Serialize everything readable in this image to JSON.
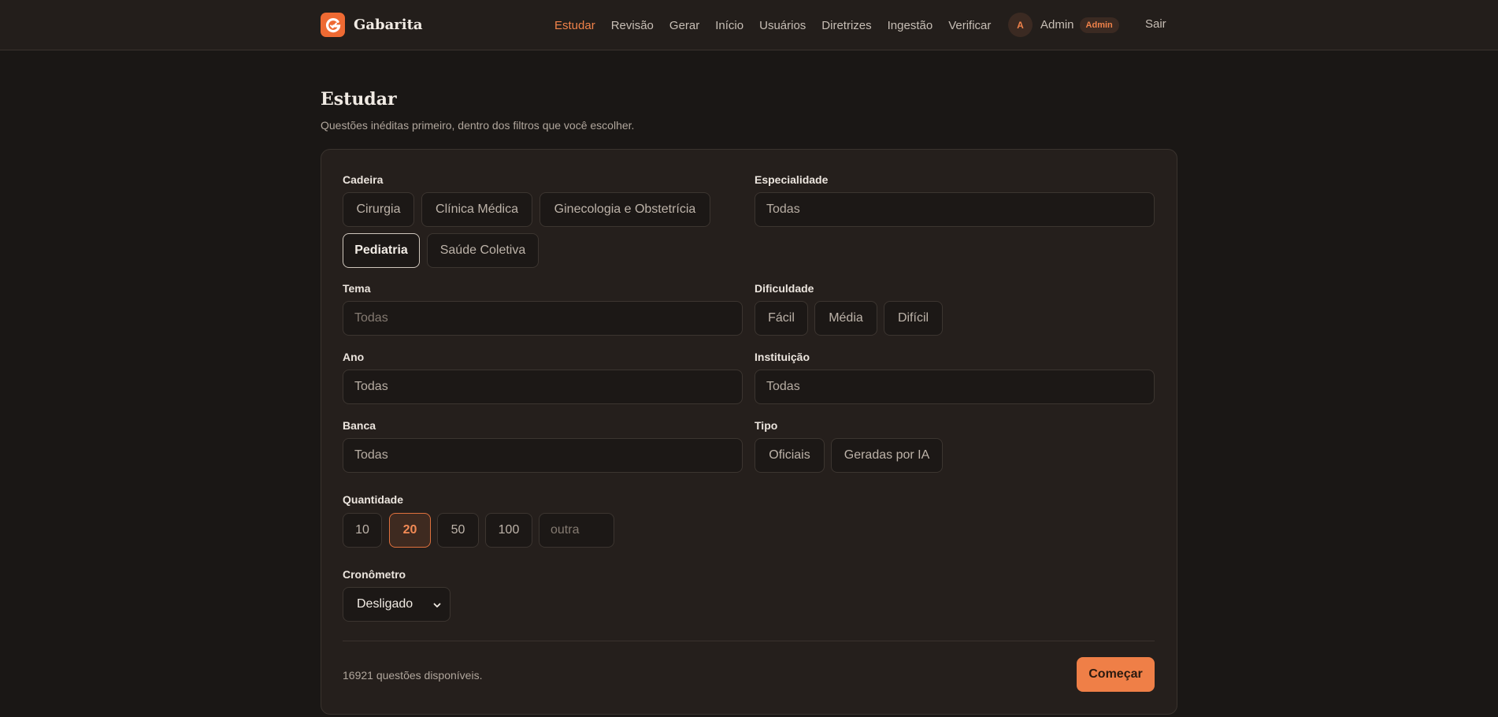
{
  "header": {
    "brand_name": "Gabarita",
    "nav": [
      {
        "label": "Estudar",
        "active": true
      },
      {
        "label": "Revisão"
      },
      {
        "label": "Gerar"
      },
      {
        "label": "Início"
      },
      {
        "label": "Usuários"
      },
      {
        "label": "Diretrizes"
      },
      {
        "label": "Ingestão"
      },
      {
        "label": "Verificar"
      }
    ],
    "user": {
      "avatar_initial": "A",
      "name": "Admin",
      "role_badge": "Admin"
    },
    "logout_label": "Sair"
  },
  "page": {
    "title": "Estudar",
    "subtitle": "Questões inéditas primeiro, dentro dos filtros que você escolher."
  },
  "filters": {
    "cadeira": {
      "label": "Cadeira",
      "options": [
        "Cirurgia",
        "Clínica Médica",
        "Ginecologia e Obstetrícia",
        "Pediatria",
        "Saúde Coletiva"
      ],
      "selected": "Pediatria"
    },
    "especialidade": {
      "label": "Especialidade",
      "value": "Todas"
    },
    "tema": {
      "label": "Tema",
      "placeholder": "Todas"
    },
    "dificuldade": {
      "label": "Dificuldade",
      "options": [
        "Fácil",
        "Média",
        "Difícil"
      ]
    },
    "ano": {
      "label": "Ano",
      "value": "Todas"
    },
    "instituicao": {
      "label": "Instituição",
      "value": "Todas"
    },
    "banca": {
      "label": "Banca",
      "value": "Todas"
    },
    "tipo": {
      "label": "Tipo",
      "options": [
        "Oficiais",
        "Geradas por IA"
      ]
    },
    "quantidade": {
      "label": "Quantidade",
      "options": [
        "10",
        "20",
        "50",
        "100"
      ],
      "selected": "20",
      "other_placeholder": "outra"
    },
    "cronometro": {
      "label": "Cronômetro",
      "value": "Desligado"
    }
  },
  "footer": {
    "available_text": "16921 questões disponíveis.",
    "start_label": "Começar"
  },
  "colors": {
    "accent": "#ef7f47",
    "background": "#1a1715",
    "card": "#251f1c"
  }
}
